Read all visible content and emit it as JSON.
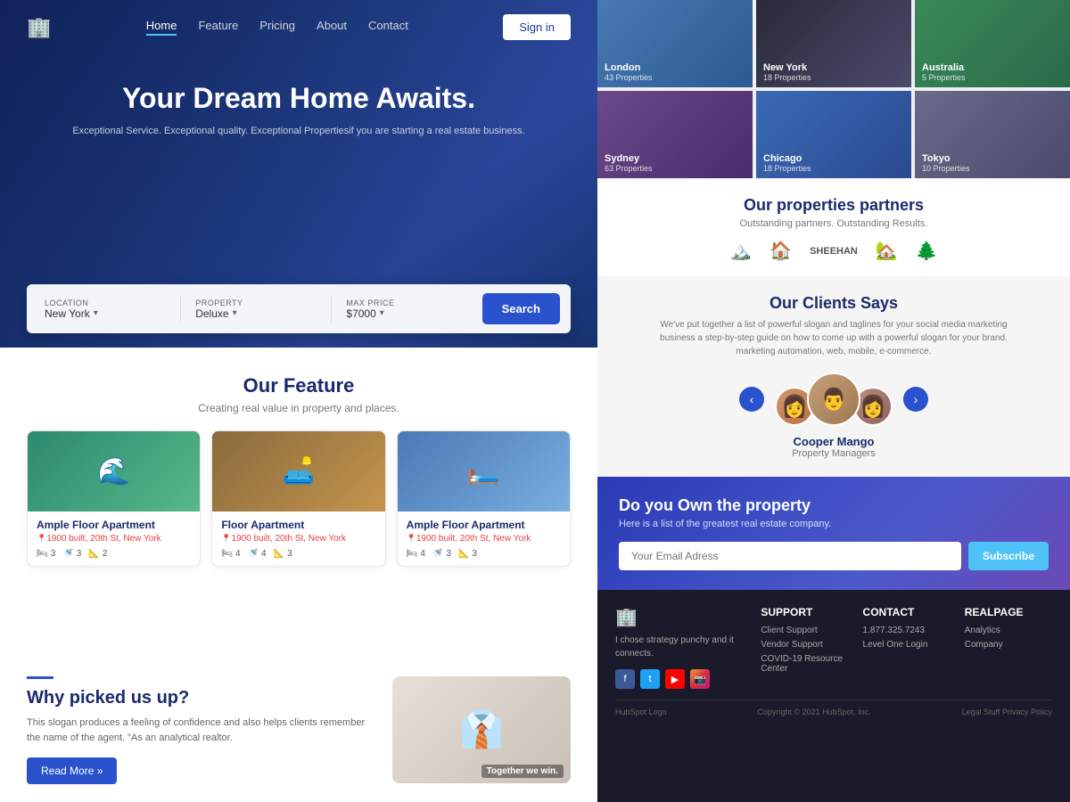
{
  "hero": {
    "title": "Your Dream Home Awaits.",
    "subtitle": "Exceptional Service. Exceptional quality. Exceptional Propertiesif you are starting a real estate business.",
    "nav": {
      "links": [
        "Home",
        "Feature",
        "Pricing",
        "About",
        "Contact"
      ],
      "active": "Home",
      "signin_label": "Sign in"
    },
    "search": {
      "location_label": "LOCATION",
      "location_val": "New York",
      "property_label": "PROPERTY",
      "property_val": "Deluxe",
      "price_label": "MAX PRICE",
      "price_val": "$7000",
      "search_btn": "Search"
    }
  },
  "features": {
    "title": "Our Feature",
    "subtitle": "Creating real value in property and places.",
    "properties": [
      {
        "name": "Ample Floor Apartment",
        "address": "1900 built, 20th St, New York",
        "beds": "3",
        "baths": "3",
        "area": "2"
      },
      {
        "name": "Floor Apartment",
        "address": "1900 built, 20th St, New York",
        "beds": "4",
        "baths": "4",
        "area": "3"
      },
      {
        "name": "Ample Floor Apartment",
        "address": "1900 built, 20th St, New York",
        "beds": "4",
        "baths": "3",
        "area": "3"
      }
    ]
  },
  "why": {
    "title": "Why picked us up?",
    "description": "This slogan produces a feeling of confidence and also helps clients remember the name of the agent. \"As an analytical realtor.",
    "readmore_label": "Read More »",
    "together_label": "Together we win."
  },
  "cities": [
    {
      "name": "London",
      "count": "43 Properties"
    },
    {
      "name": "New York",
      "count": "18 Properties"
    },
    {
      "name": "Australia",
      "count": "5 Properties"
    },
    {
      "name": "Sydney",
      "count": "63 Properties"
    },
    {
      "name": "Chicago",
      "count": "18 Properties"
    },
    {
      "name": "Tokyo",
      "count": "10 Properties"
    }
  ],
  "partners": {
    "title": "Our properties partners",
    "subtitle": "Outstanding partners. Outstanding Results.",
    "logos": [
      "🏔️",
      "🏠",
      "SHEEHAN",
      "🏡",
      "🌲"
    ]
  },
  "testimonials": {
    "title": "Our Clients Says",
    "description": "We've put together a list of powerful slogan and taglines for your social media marketing business a step-by-step guide on how to come up with a powerful slogan for your brand. marketing automation, web, mobile, e-commerce.",
    "current_name": "Cooper Mango",
    "current_role": "Property Managers",
    "prev_btn": "‹",
    "next_btn": "›"
  },
  "cta": {
    "title": "Do you Own the property",
    "subtitle": "Here is a list of the greatest real estate company.",
    "input_placeholder": "Your Email Adress",
    "subscribe_label": "Subscribe"
  },
  "footer": {
    "logo_icon": "🏢",
    "tagline": "I chose strategy punchy and it connects.",
    "social": [
      "f",
      "t",
      "▶",
      "📷"
    ],
    "columns": [
      {
        "title": "SUPPORT",
        "links": [
          "Client Support",
          "Vendor Support",
          "COVID-19 Resource Center"
        ]
      },
      {
        "title": "CONTACT",
        "links": [
          "1.877.325.7243",
          "Level One Login"
        ]
      },
      {
        "title": "REALPAGE",
        "links": [
          "Analytics",
          "Company"
        ]
      }
    ],
    "bottom": {
      "left": "HubSpot Logo",
      "center": "Copyright © 2021 HubSpot, Inc.",
      "right": "Legal Stuff Privacy Policy"
    }
  }
}
